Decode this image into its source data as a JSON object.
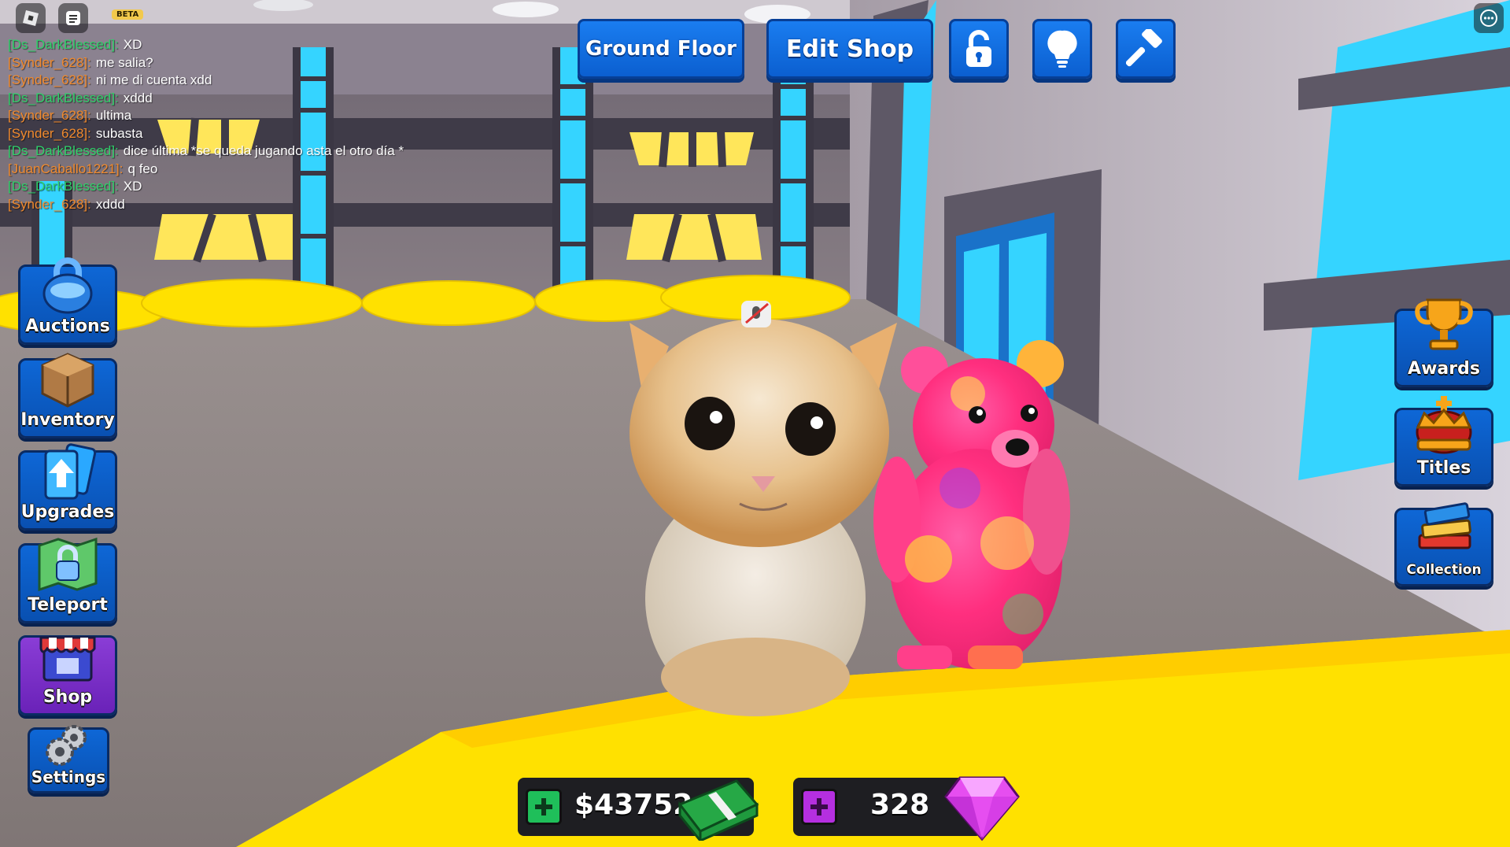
{
  "topbar": {
    "beta_badge": "BETA",
    "ground_floor_label": "Ground Floor",
    "edit_shop_label": "Edit Shop",
    "icons": [
      "unlock-icon",
      "lightbulb-icon",
      "hammer-icon"
    ]
  },
  "chat": {
    "messages": [
      {
        "name": "[Ds_DarkBlessed]:",
        "text": "XD",
        "color": "#2fd06a"
      },
      {
        "name": "[Synder_628]:",
        "text": "me salia?",
        "color": "#f08a2e"
      },
      {
        "name": "[Synder_628]:",
        "text": "ni me di cuenta xdd",
        "color": "#f08a2e"
      },
      {
        "name": "[Ds_DarkBlessed]:",
        "text": "xddd",
        "color": "#2fd06a"
      },
      {
        "name": "[Synder_628]:",
        "text": "ultima",
        "color": "#f08a2e"
      },
      {
        "name": "[Synder_628]:",
        "text": "subasta",
        "color": "#f08a2e"
      },
      {
        "name": "[Ds_DarkBlessed]:",
        "text": "dice última *se queda jugando asta el otro día *",
        "color": "#2fd06a"
      },
      {
        "name": "[JuanCaballo1221]:",
        "text": "q feo",
        "color": "#f08a2e"
      },
      {
        "name": "[Ds_DarkBlessed]:",
        "text": "XD",
        "color": "#2fd06a"
      },
      {
        "name": "[Synder_628]:",
        "text": "xddd",
        "color": "#f08a2e"
      }
    ]
  },
  "left_menu": {
    "auctions": "Auctions",
    "inventory": "Inventory",
    "upgrades": "Upgrades",
    "teleport": "Teleport",
    "shop": "Shop",
    "settings": "Settings"
  },
  "right_menu": {
    "awards": "Awards",
    "titles": "Titles",
    "collection": "Collection"
  },
  "currency": {
    "cash": "$43752",
    "gems": "328"
  },
  "colors": {
    "button_blue": "#0b5fd0",
    "shop_purple": "#7a2fc8",
    "cash_green": "#1fbf5a",
    "gem_purple": "#b52fe0",
    "floor_yellow": "#ffe100"
  }
}
